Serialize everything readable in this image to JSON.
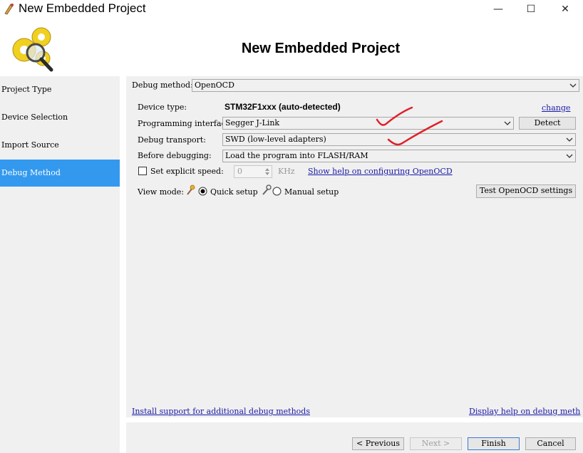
{
  "window": {
    "title": "New Embedded Project",
    "minimize_glyph": "—",
    "maximize_glyph": "☐",
    "close_glyph": "✕"
  },
  "header": {
    "title": "New Embedded Project",
    "logo_icon": "gears-magnifier-icon"
  },
  "nav": {
    "items": [
      {
        "label": "Project Type"
      },
      {
        "label": "Device Selection"
      },
      {
        "label": "Import Source"
      },
      {
        "label": "Debug Method"
      }
    ],
    "active_index": 3
  },
  "form": {
    "debug_method_label": "Debug method:",
    "debug_method_value": "OpenOCD",
    "device_type_label": "Device type:",
    "device_type_value": "STM32F1xxx (auto-detected)",
    "change_link": "change",
    "prog_interface_label": "Programming interfac",
    "prog_interface_value": "Segger J-Link",
    "detect_button": "Detect",
    "debug_transport_label": "Debug transport:",
    "debug_transport_value": "SWD (low-level adapters)",
    "before_debugging_label": "Before debugging:",
    "before_debugging_value": "Load the program into FLASH/RAM",
    "explicit_speed_label": "Set explicit speed:",
    "explicit_speed_checked": false,
    "speed_value": "0",
    "speed_unit": "KHz",
    "help_link": "Show help on configuring OpenOCD",
    "view_mode_label": "View mode:",
    "quick_setup_label": "Quick setup",
    "manual_setup_label": "Manual setup",
    "view_mode_selected": "Quick setup",
    "test_button": "Test OpenOCD settings"
  },
  "links": {
    "install_support": "Install support for additional debug methods",
    "display_help": "Display help on debug meth"
  },
  "buttons": {
    "previous": "< Previous",
    "next": "Next >",
    "finish": "Finish",
    "cancel": "Cancel"
  },
  "annotations": {
    "color": "#e0202a"
  }
}
